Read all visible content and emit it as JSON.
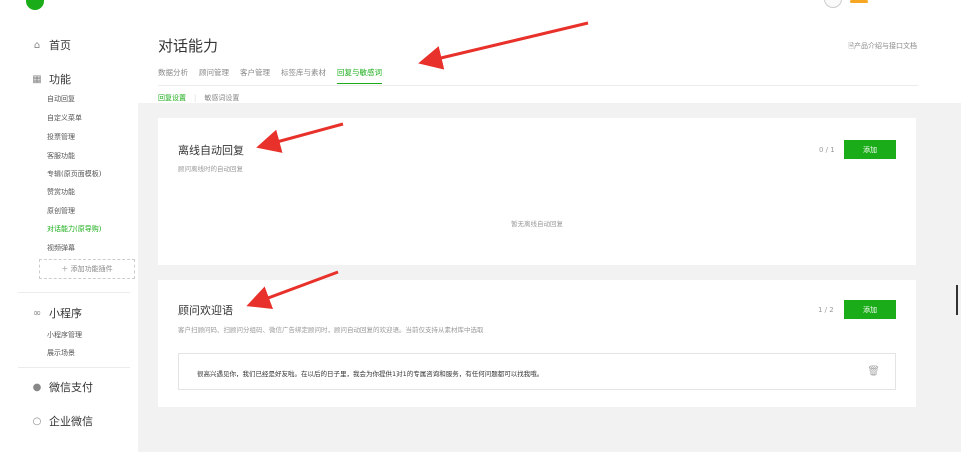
{
  "sidebar": {
    "home": {
      "icon": "home-icon",
      "label": "首页"
    },
    "features": {
      "icon": "grid-icon",
      "label": "功能"
    },
    "feature_items": [
      "自动回复",
      "自定义菜单",
      "投票管理",
      "客服功能",
      "专辑(原页面模板)",
      "赞赏功能",
      "原创管理",
      "对话能力(原导购)",
      "视频弹幕"
    ],
    "active_feature": "对话能力(原导购)",
    "add_plugin": "＋ 添加功能插件",
    "miniprogram": {
      "icon": "link-icon",
      "label": "小程序"
    },
    "miniprogram_items": [
      "小程序管理",
      "展示场景"
    ],
    "wechat_pay": {
      "icon": "wechat-pay-icon",
      "label": "微信支付"
    },
    "work_wechat": {
      "icon": "work-wechat-icon",
      "label": "企业微信"
    }
  },
  "header": {
    "title": "对话能力",
    "doc_link": "产品介绍与接口文档"
  },
  "tabs": [
    "数据分析",
    "顾问管理",
    "客户管理",
    "标签库与素材",
    "回复与敏感词"
  ],
  "active_tab": "回复与敏感词",
  "subtabs": [
    "回复设置",
    "敏感词设置"
  ],
  "active_subtab": "回复设置",
  "offline_card": {
    "title": "离线自动回复",
    "desc": "顾问离线时的自动回复",
    "count": "0 / 1",
    "add_label": "添加",
    "empty_text": "暂无离线自动回复"
  },
  "welcome_card": {
    "title": "顾问欢迎语",
    "desc": "客户扫顾问码、扫顾问分组码、微信广告绑定顾问时，顾问自动回复的欢迎语。当前仅支持从素材库中选取",
    "count": "1 / 2",
    "add_label": "添加",
    "greeting": "很高兴遇见你，我们已经是好友啦。在以后的日子里，我会为你提供1对1的专属咨询和服务，有任何问题都可以找我哦。"
  },
  "colors": {
    "accent": "#1aad19",
    "arrow": "#e8312a"
  }
}
